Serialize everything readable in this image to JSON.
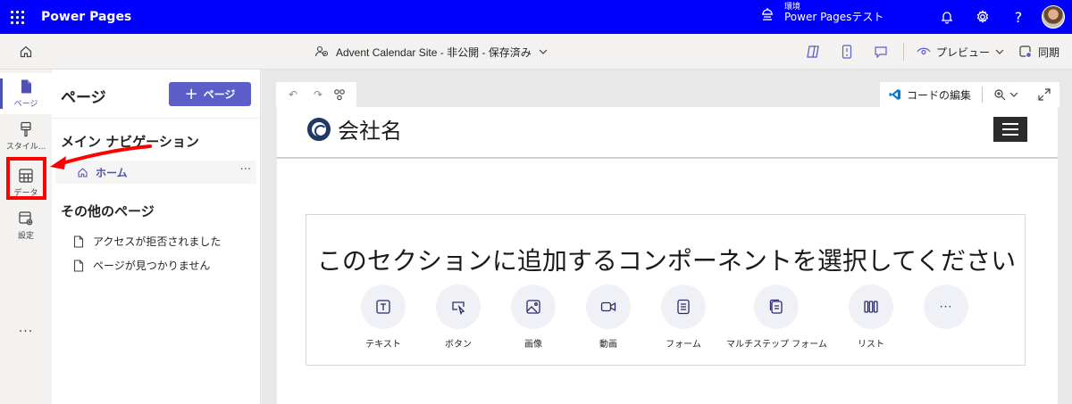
{
  "topbar": {
    "app_title": "Power Pages",
    "env_label": "環境",
    "env_name": "Power Pagesテスト"
  },
  "subbar": {
    "site_info": "Advent Calendar Site - 非公開 - 保存済み",
    "preview_label": "プレビュー",
    "sync_label": "同期"
  },
  "rail": {
    "items": [
      {
        "label": "ページ"
      },
      {
        "label": "スタイル..."
      },
      {
        "label": "データ"
      },
      {
        "label": "設定"
      }
    ],
    "more": "..."
  },
  "panel": {
    "title": "ページ",
    "add_page_label": "ページ",
    "main_nav_heading": "メイン ナビゲーション",
    "home_item": "ホーム",
    "row_more": "···",
    "other_heading": "その他のページ",
    "other_pages": [
      {
        "label": "アクセスが拒否されました"
      },
      {
        "label": "ページが見つかりません"
      }
    ]
  },
  "canvas": {
    "code_edit_label": "コードの編集"
  },
  "preview": {
    "company_name": "会社名",
    "section_prompt": "このセクションに追加するコンポーネントを選択してください",
    "components": [
      {
        "label": "テキスト",
        "icon": "text-icon"
      },
      {
        "label": "ボタン",
        "icon": "button-icon"
      },
      {
        "label": "画像",
        "icon": "image-icon"
      },
      {
        "label": "動画",
        "icon": "video-icon"
      },
      {
        "label": "フォーム",
        "icon": "form-icon"
      },
      {
        "label": "マルチステップ フォーム",
        "icon": "multistep-form-icon"
      },
      {
        "label": "リスト",
        "icon": "list-icon"
      },
      {
        "label": "",
        "icon": "more-icon"
      }
    ]
  },
  "colors": {
    "brand_blue": "#0000ff",
    "accent": "#5b5fc7",
    "highlight_red": "#ff0000"
  }
}
